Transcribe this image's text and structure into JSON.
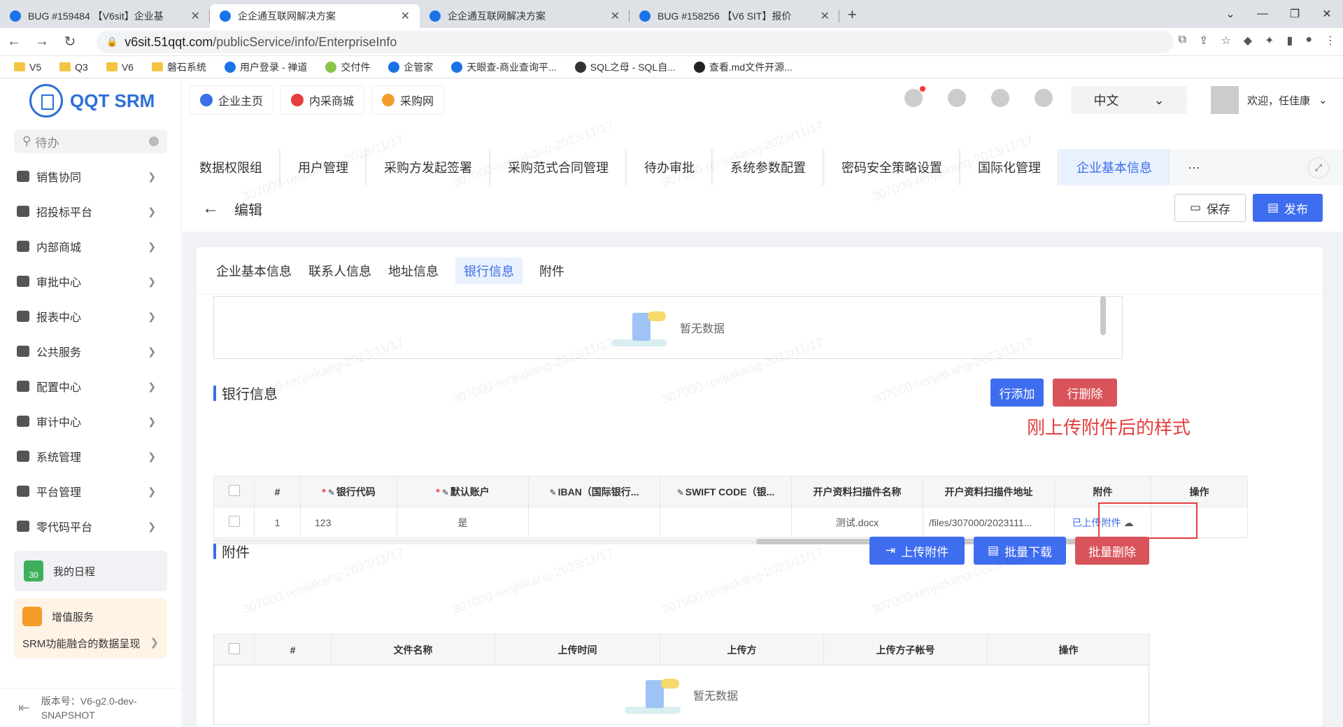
{
  "browser": {
    "tabs": [
      {
        "title": "BUG #159484 【V6sit】企业基",
        "active": false
      },
      {
        "title": "企企通互联网解决方案",
        "active": true
      },
      {
        "title": "企企通互联网解决方案",
        "active": false
      },
      {
        "title": "BUG #158256 【V6 SIT】报价",
        "active": false
      }
    ],
    "url_domain": "v6sit.51qqt.com",
    "url_path": "/publicService/info/EnterpriseInfo",
    "bookmarks": [
      "V5",
      "Q3",
      "V6",
      "磐石系统",
      "用户登录 - 禅道",
      "交付件",
      "企管家",
      "天眼查-商业查询平...",
      "SQL之母 - SQL自...",
      "查看.md文件开源..."
    ]
  },
  "sidebar": {
    "logo": "QQT SRM",
    "search_placeholder": "待办",
    "menu": [
      "销售协同",
      "招投标平台",
      "内部商城",
      "审批中心",
      "报表中心",
      "公共服务",
      "配置中心",
      "审计中心",
      "系统管理",
      "平台管理",
      "零代码平台"
    ],
    "schedule": "我的日程",
    "calendar_day": "30",
    "vas_title": "增值服务",
    "vas_desc": "SRM功能融合的数据呈现",
    "version": "版本号：V6-g2.0-dev-SNAPSHOT"
  },
  "header": {
    "sys_buttons": [
      "企业主页",
      "内采商城",
      "采购网"
    ],
    "language": "中文",
    "welcome": "欢迎，任佳康"
  },
  "nav_tabs": [
    "数据权限组",
    "用户管理",
    "采购方发起签署",
    "采购范式合同管理",
    "待办审批",
    "系统参数配置",
    "密码安全策略设置",
    "国际化管理",
    "企业基本信息"
  ],
  "nav_more": "···",
  "edit": {
    "back_label": "编辑",
    "save": "保存",
    "publish": "发布"
  },
  "sub_tabs": [
    "企业基本信息",
    "联系人信息",
    "地址信息",
    "银行信息",
    "附件"
  ],
  "empty_text": "暂无数据",
  "bank": {
    "title": "银行信息",
    "add": "行添加",
    "delete": "行删除",
    "columns": [
      "#",
      "银行代码",
      "默认账户",
      "IBAN（国际银行...",
      "SWIFT CODE（银...",
      "开户资料扫描件名称",
      "开户资料扫描件地址",
      "附件",
      "操作"
    ],
    "row": {
      "index": "1",
      "bank_code": "123",
      "default_account": "是",
      "iban": "",
      "swift": "",
      "scan_name": "测试.docx",
      "scan_addr": "/files/307000/2023111...",
      "attachment": "已上传附件",
      "action": ""
    }
  },
  "annotation": "刚上传附件后的样式",
  "attachments": {
    "title": "附件",
    "upload": "上传附件",
    "download": "批量下载",
    "delete": "批量删除",
    "columns": [
      "#",
      "文件名称",
      "上传时间",
      "上传方",
      "上传方子帐号",
      "操作"
    ]
  },
  "watermark": "307000-renjiakang-2023/11/17"
}
